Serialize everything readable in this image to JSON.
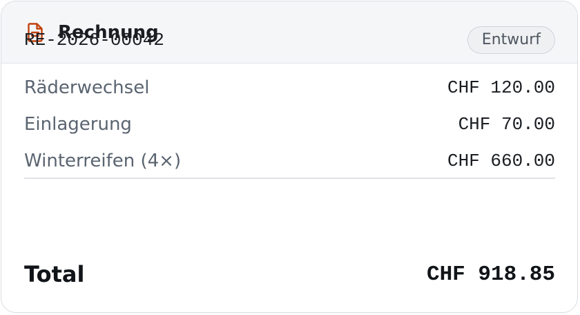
{
  "card": {
    "title": "Rechnung",
    "icon": "document-icon",
    "accent_color": "#c2410c"
  },
  "invoice": {
    "number": "RE-2026-00042",
    "status": "Entwurf",
    "line_items": [
      {
        "description": "Räderwechsel",
        "amount": "CHF 120.00"
      },
      {
        "description": "Einlagerung",
        "amount": "CHF 70.00"
      },
      {
        "description": "Winterreifen (4×)",
        "amount": "CHF 660.00"
      }
    ],
    "total_label": "Total",
    "total_amount": "CHF 918.85"
  }
}
